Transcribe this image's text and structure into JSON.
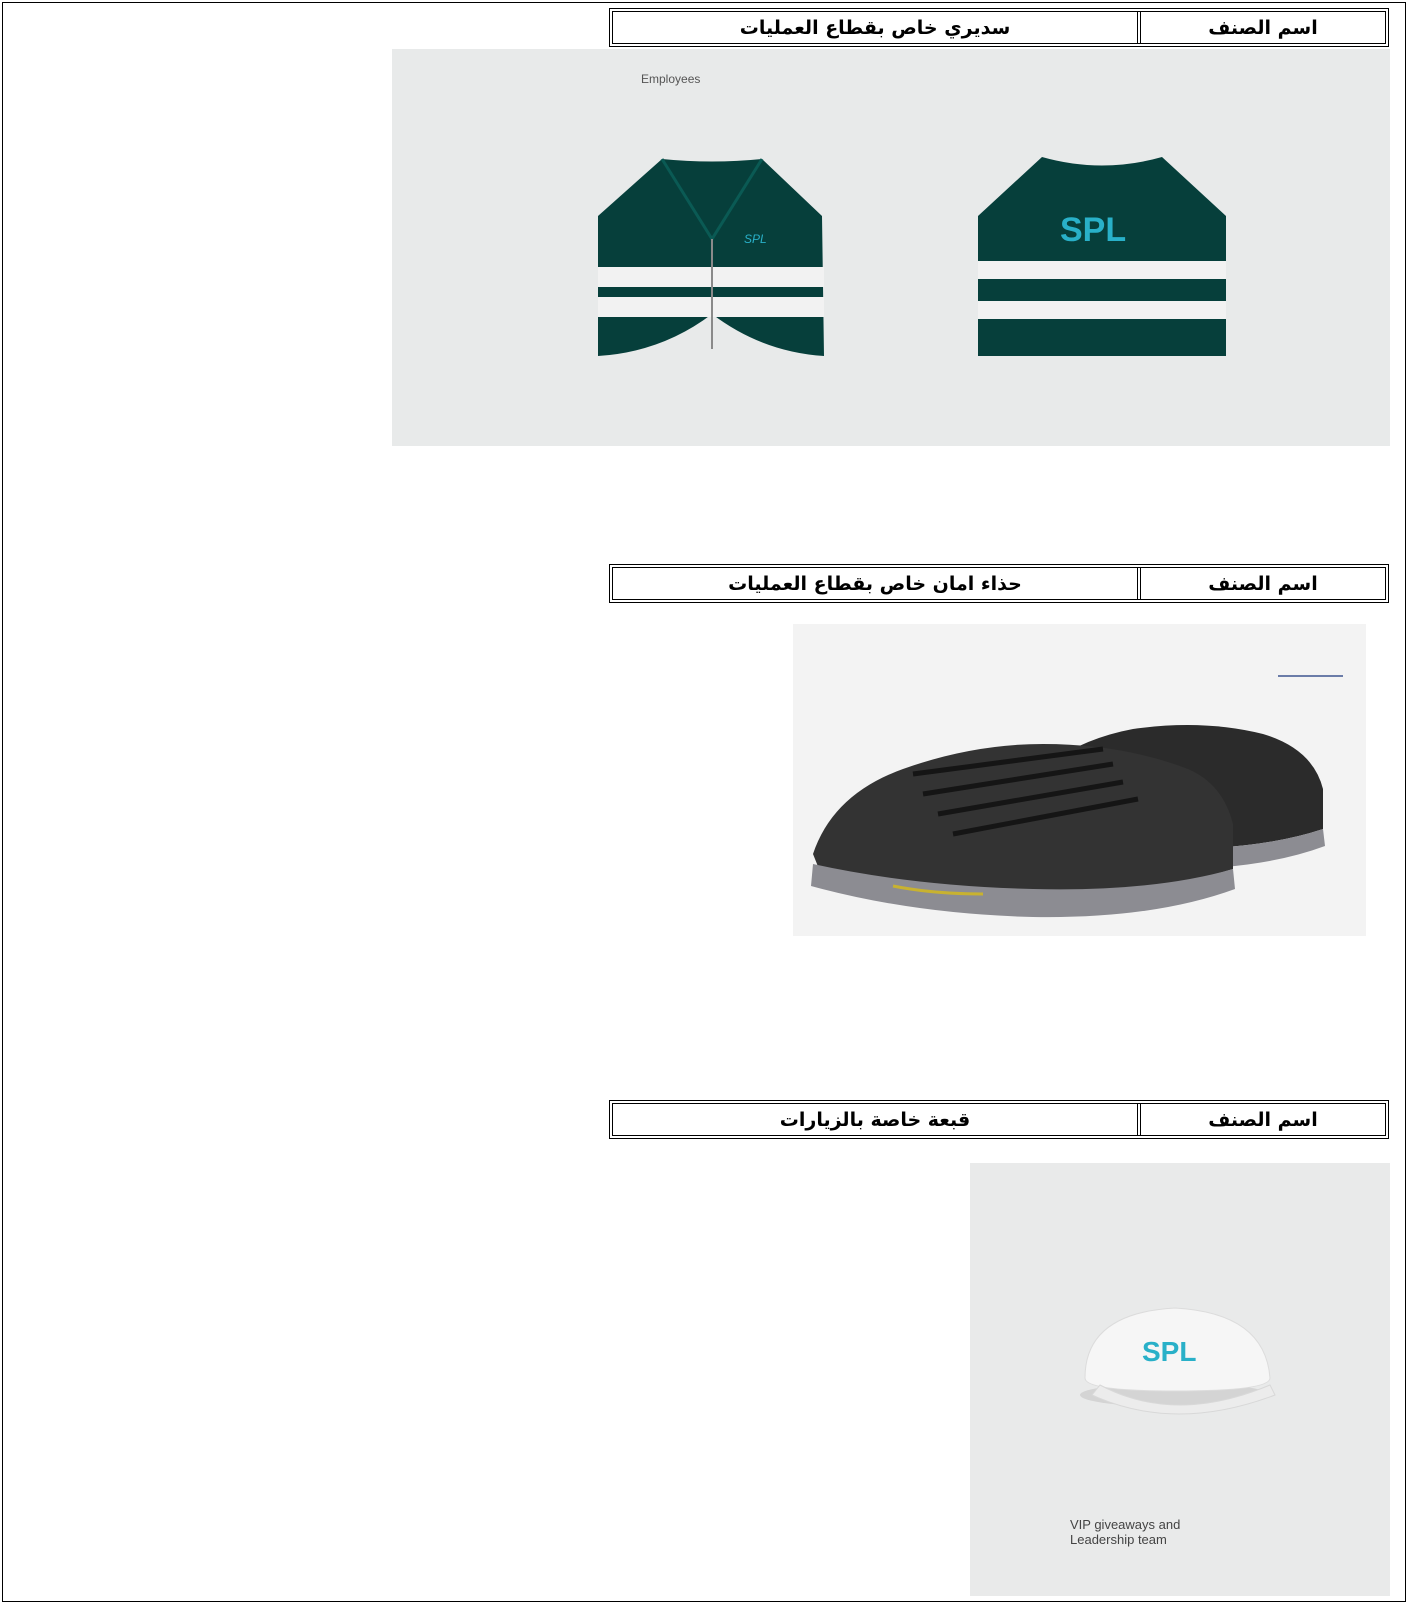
{
  "items": [
    {
      "key_label": "اسم الصنف",
      "name": "سديري خاص بقطاع العمليات",
      "image": {
        "icon": "safety-vest-icon",
        "caption": "Employees",
        "logo_text": "SPL",
        "colors": {
          "vest": "#063f3b",
          "stripe": "#f2f2f2",
          "logo": "#29b0c8"
        }
      }
    },
    {
      "key_label": "اسم الصنف",
      "name": "حذاء امان خاص بقطاع العمليات",
      "image": {
        "icon": "safety-shoes-icon",
        "colors": {
          "upper": "#2b2b2b",
          "sole": "#8c8c92"
        }
      }
    },
    {
      "key_label": "اسم الصنف",
      "name": "قبعة خاصة بالزيارات",
      "image": {
        "icon": "cap-icon",
        "caption": "VIP giveaways and\nLeadership team",
        "logo_text": "SPL",
        "colors": {
          "cap": "#f6f6f6",
          "logo": "#29b0c8"
        }
      }
    }
  ]
}
